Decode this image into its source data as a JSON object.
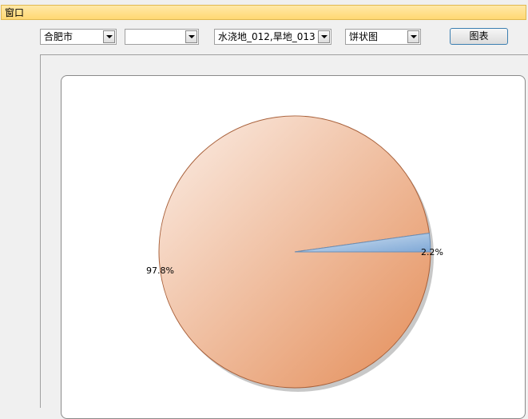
{
  "window": {
    "title": "窗口"
  },
  "toolbar": {
    "city_select": {
      "value": "合肥市"
    },
    "district_select": {
      "value": ""
    },
    "landuse_select": {
      "value": "水浇地_012,旱地_013"
    },
    "chart_type_select": {
      "value": "饼状图"
    },
    "chart_button_label": "图表"
  },
  "colors": {
    "titlebar": "#ffd872",
    "slice_large": "#e8956a",
    "slice_small": "#8fb4dc"
  },
  "chart_data": {
    "type": "pie",
    "slices": [
      {
        "label": "97.8%",
        "value": 97.8,
        "color": "#e8956a"
      },
      {
        "label": "2.2%",
        "value": 2.2,
        "color": "#8fb4dc"
      }
    ]
  }
}
